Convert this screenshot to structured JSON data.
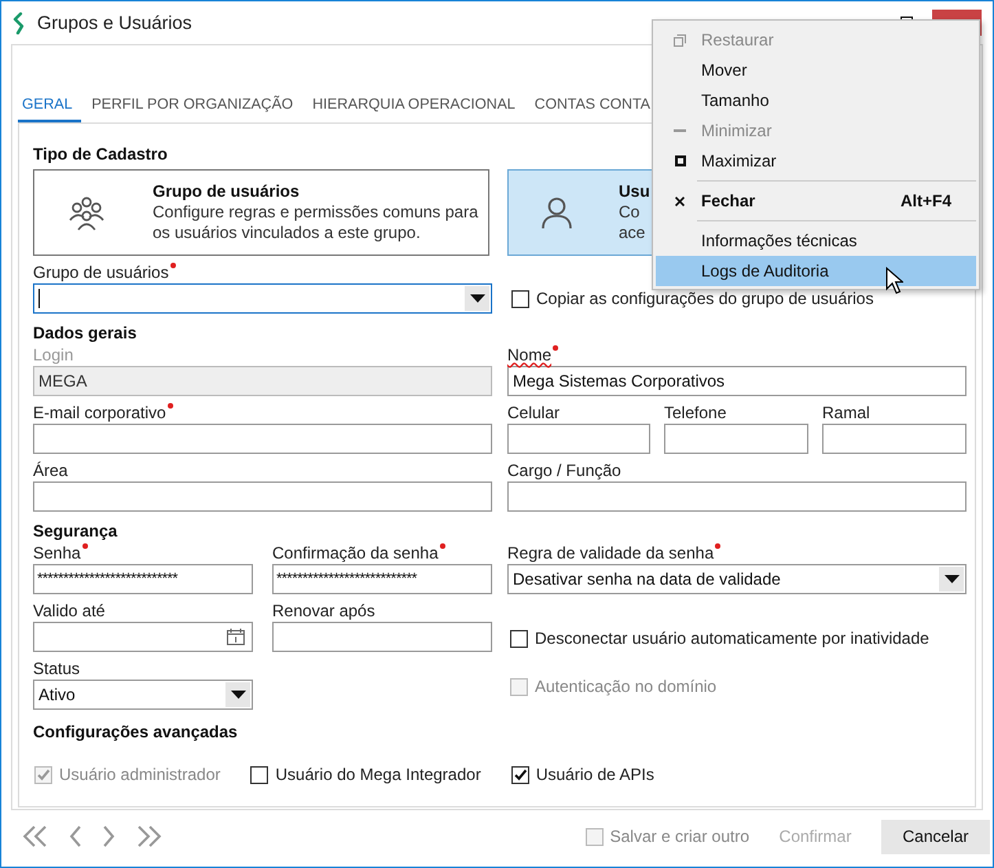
{
  "window": {
    "title": "Grupos e Usuários"
  },
  "tabs": [
    {
      "label": "GERAL",
      "selected": true
    },
    {
      "label": "PERFIL POR ORGANIZAÇÃO",
      "selected": false
    },
    {
      "label": "HIERARQUIA OPERACIONAL",
      "selected": false
    },
    {
      "label": "CONTAS CONTA",
      "selected": false
    }
  ],
  "registration_type": {
    "heading": "Tipo de Cadastro",
    "cards": [
      {
        "kind": "group",
        "title": "Grupo de usuários",
        "description": [
          "Configure regras e permissões comuns para",
          "os usuários vinculados a este grupo."
        ],
        "selected": false
      },
      {
        "kind": "user",
        "title": "Usu",
        "description": [
          "Co",
          "ace"
        ],
        "selected": true
      }
    ]
  },
  "user_group": {
    "label": "Grupo de usuários",
    "required": true,
    "focused": true,
    "copy_checkbox": {
      "label": "Copiar as configurações do grupo de usuários",
      "checked": false,
      "disabled": false
    }
  },
  "general": {
    "heading": "Dados gerais",
    "login": {
      "label": "Login",
      "value": "MEGA",
      "disabled": true,
      "required": false
    },
    "name": {
      "label": "Nome",
      "value": "Mega Sistemas Corporativos",
      "disabled": false,
      "required": true
    },
    "email": {
      "label": "E-mail corporativo",
      "disabled": false,
      "required": true
    },
    "mobile": {
      "label": "Celular",
      "disabled": false,
      "required": false
    },
    "phone": {
      "label": "Telefone",
      "disabled": false,
      "required": false
    },
    "extension": {
      "label": "Ramal",
      "disabled": false,
      "required": false
    },
    "area": {
      "label": "Área",
      "disabled": false,
      "required": false
    },
    "role": {
      "label": "Cargo / Função",
      "disabled": false,
      "required": false
    }
  },
  "security": {
    "heading": "Segurança",
    "password": {
      "label": "Senha",
      "value": "***************************",
      "required": true
    },
    "confirmation": {
      "label": "Confirmação da senha",
      "value": "***************************",
      "required": true
    },
    "rule": {
      "label": "Regra de validade da senha",
      "value": "Desativar senha na data de validade",
      "required": true
    },
    "valid_until": {
      "label": "Valido até",
      "required": false
    },
    "renew_after": {
      "label": "Renovar após",
      "required": false
    },
    "disconnect": {
      "label": "Desconectar usuário automaticamente por inatividade",
      "checked": false,
      "disabled": false
    },
    "status": {
      "label": "Status",
      "value": "Ativo",
      "required": false
    },
    "domain_auth": {
      "label": "Autenticação no domínio",
      "checked": false,
      "disabled": true
    }
  },
  "advanced": {
    "heading": "Configurações avançadas",
    "checkboxes": [
      {
        "label": "Usuário administrador",
        "checked": true,
        "disabled": true
      },
      {
        "label": "Usuário do Mega Integrador",
        "checked": false,
        "disabled": false
      },
      {
        "label": "Usuário de APIs",
        "checked": true,
        "disabled": false
      }
    ]
  },
  "footer": {
    "save_and_new": {
      "label": "Salvar e criar outro",
      "checked": false,
      "disabled": true
    },
    "confirm": {
      "label": "Confirmar",
      "disabled": true
    },
    "cancel": {
      "label": "Cancelar",
      "disabled": false
    }
  },
  "context_menu": {
    "items": [
      {
        "kind": "restore",
        "label": "Restaurar",
        "disabled": true,
        "default": false,
        "selected": false
      },
      {
        "kind": "plain",
        "label": "Mover",
        "disabled": false,
        "default": false,
        "selected": false
      },
      {
        "kind": "plain",
        "label": "Tamanho",
        "disabled": false,
        "default": false,
        "selected": false
      },
      {
        "kind": "minimize",
        "label": "Minimizar",
        "disabled": true,
        "default": false,
        "selected": false
      },
      {
        "kind": "maximize",
        "label": "Maximizar",
        "disabled": false,
        "default": false,
        "selected": false
      },
      {
        "kind": "separator"
      },
      {
        "kind": "close",
        "label": "Fechar",
        "shortcut": "Alt+F4",
        "disabled": false,
        "default": true,
        "selected": false
      },
      {
        "kind": "separator"
      },
      {
        "kind": "plain",
        "label": "Informações técnicas",
        "disabled": false,
        "default": false,
        "selected": false
      },
      {
        "kind": "plain",
        "label": "Logs de Auditoria",
        "disabled": false,
        "default": false,
        "selected": true
      }
    ]
  }
}
